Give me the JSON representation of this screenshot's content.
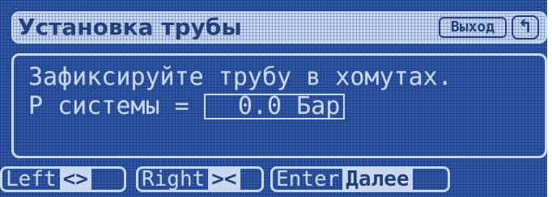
{
  "title_bar": {
    "title": "Установка трубы",
    "exit_label": "Выход",
    "return_icon": "↰",
    "return_icon_name": "return-arrow-icon"
  },
  "panel": {
    "line1": "Зафиксируйте трубу в хомутах.",
    "line2_prefix": "P системы = ",
    "pressure_value": "__0.0 Бар"
  },
  "buttons": [
    {
      "key": "Left",
      "tag": "<>"
    },
    {
      "key": "Right",
      "tag": "><"
    },
    {
      "key": "Enter",
      "tag": "Далее"
    }
  ],
  "colors": {
    "background": "#2f57a7",
    "foreground": "#c9d8ee",
    "dark_text": "#23407e"
  }
}
